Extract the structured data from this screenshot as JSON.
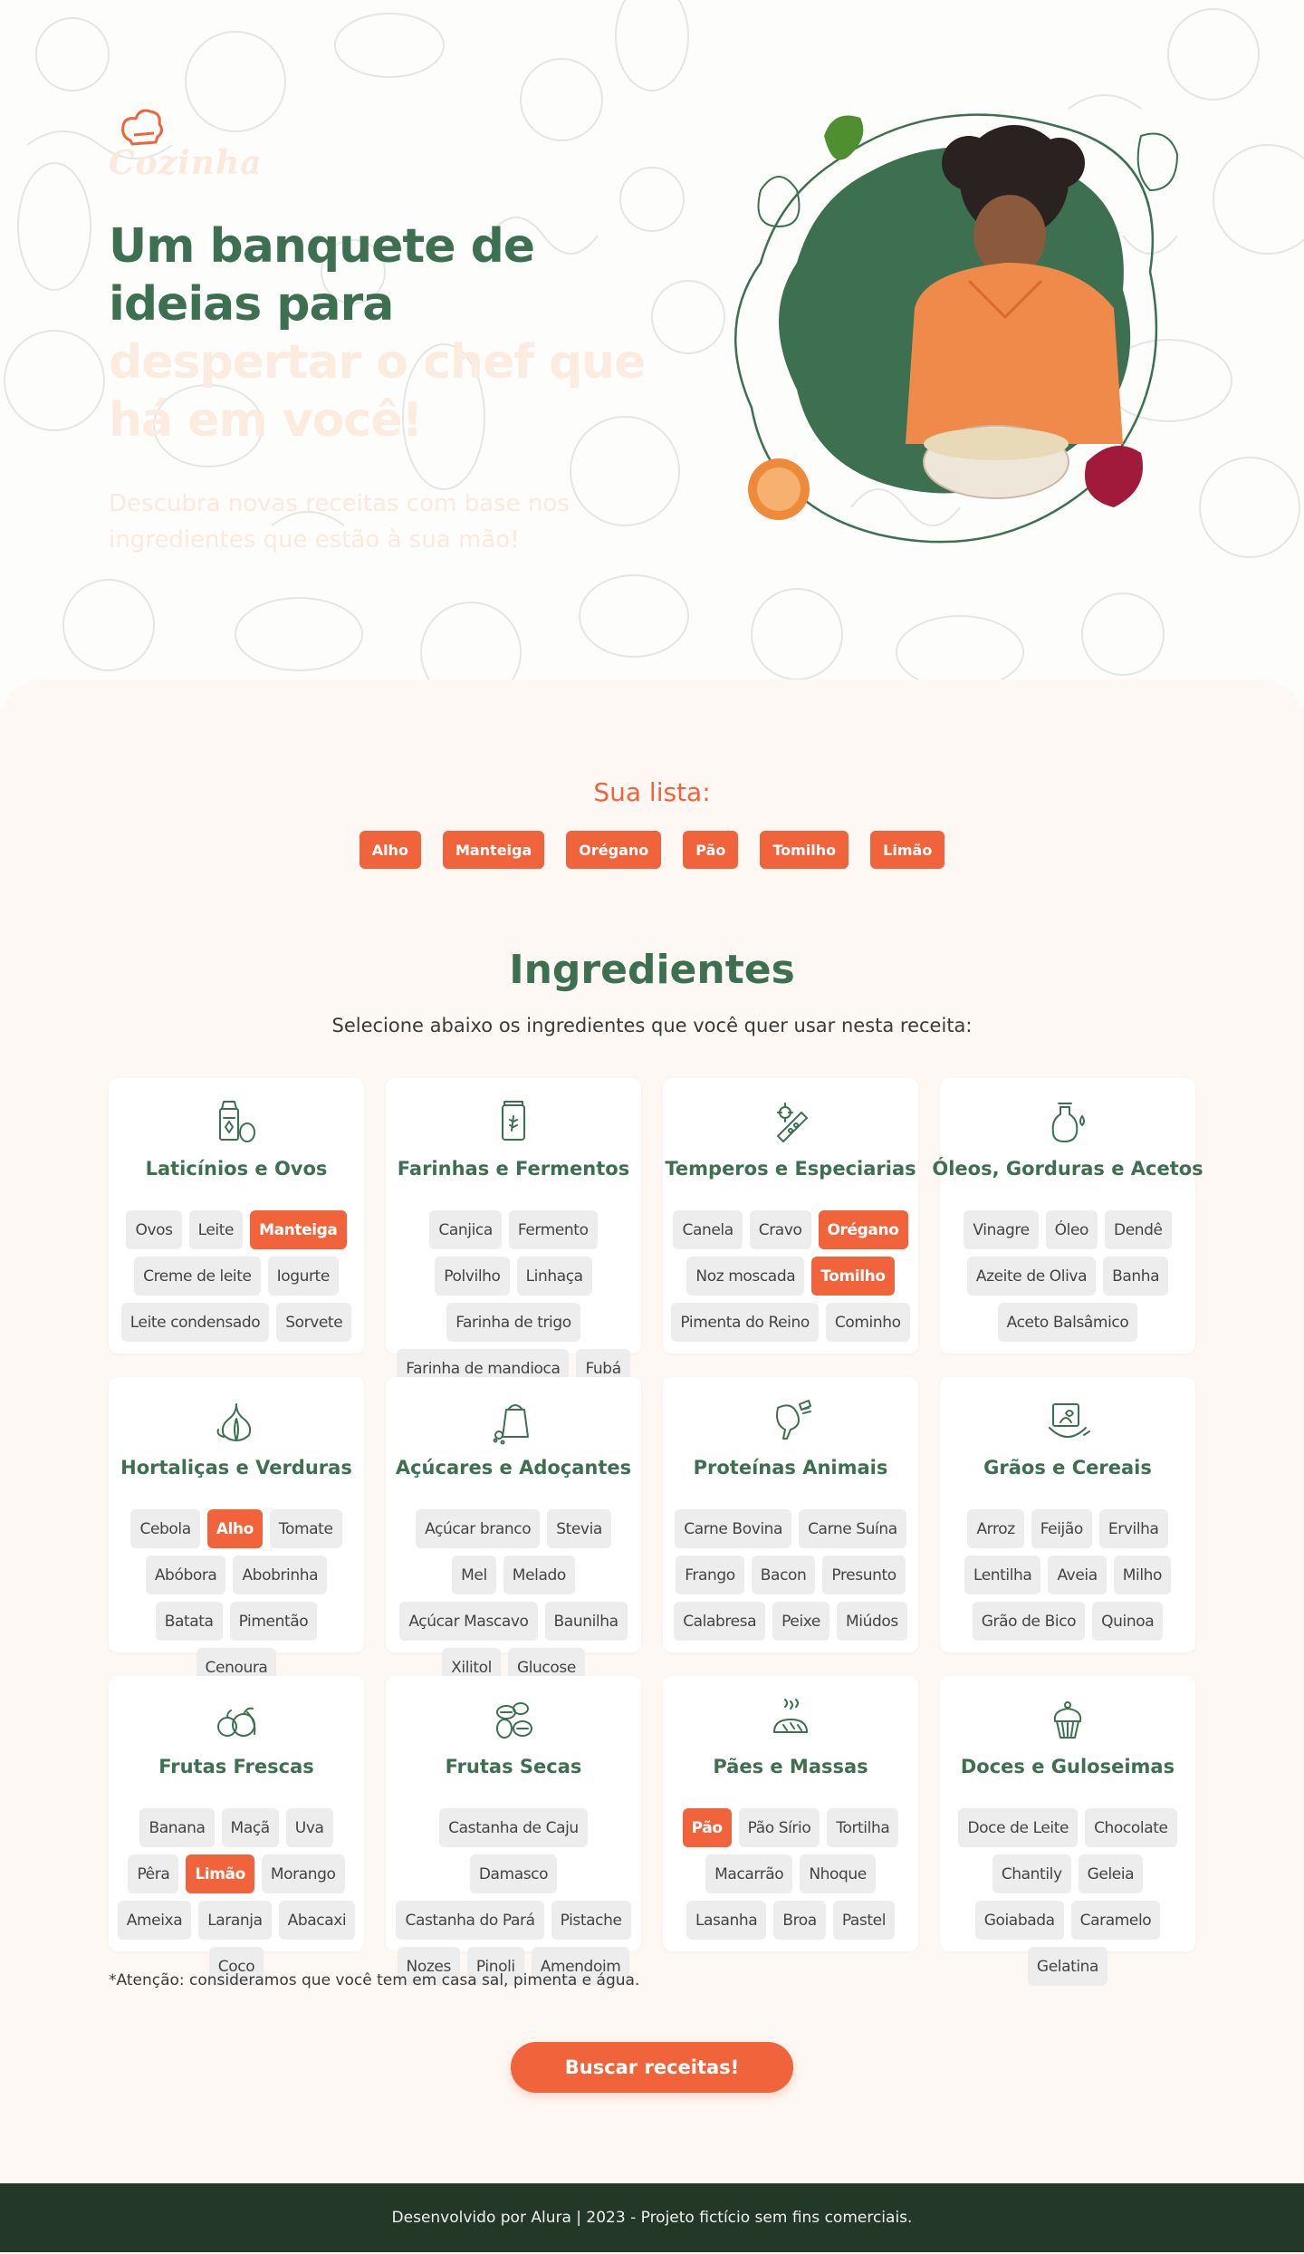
{
  "brand": {
    "logo_text": "Cozinha",
    "accent_orange": "#f0633b",
    "accent_green": "#3d7050",
    "footer_bg": "#233826"
  },
  "hero": {
    "title_line1": "Um banquete de",
    "title_line2": "ideias para",
    "title_line3": "despertar o chef que",
    "title_line4": "há em você!",
    "subtitle": "Descubra novas receitas com base nos ingredientes que estão à sua mão!"
  },
  "list": {
    "title": "Sua lista:",
    "items": [
      "Alho",
      "Manteiga",
      "Orégano",
      "Pão",
      "Tomilho",
      "Limão"
    ]
  },
  "ingredients": {
    "title": "Ingredientes",
    "subtitle": "Selecione abaixo os ingredientes que você quer usar nesta receita:",
    "categories": [
      {
        "name": "Laticínios e Ovos",
        "icon": "milk-egg-icon",
        "items": [
          {
            "label": "Ovos",
            "selected": false
          },
          {
            "label": "Leite",
            "selected": false
          },
          {
            "label": "Manteiga",
            "selected": true
          },
          {
            "label": "Creme de leite",
            "selected": false
          },
          {
            "label": "Iogurte",
            "selected": false
          },
          {
            "label": "Leite condensado",
            "selected": false
          },
          {
            "label": "Sorvete",
            "selected": false
          }
        ]
      },
      {
        "name": "Farinhas e Fermentos",
        "icon": "flour-jar-icon",
        "items": [
          {
            "label": "Canjica",
            "selected": false
          },
          {
            "label": "Fermento",
            "selected": false
          },
          {
            "label": "Polvilho",
            "selected": false
          },
          {
            "label": "Linhaça",
            "selected": false
          },
          {
            "label": "Farinha de trigo",
            "selected": false
          },
          {
            "label": "Farinha de mandioca",
            "selected": false
          },
          {
            "label": "Fubá",
            "selected": false
          }
        ]
      },
      {
        "name": "Temperos e Especiarias",
        "icon": "spices-icon",
        "items": [
          {
            "label": "Canela",
            "selected": false
          },
          {
            "label": "Cravo",
            "selected": false
          },
          {
            "label": "Orégano",
            "selected": true
          },
          {
            "label": "Noz moscada",
            "selected": false
          },
          {
            "label": "Tomilho",
            "selected": true
          },
          {
            "label": "Pimenta do Reino",
            "selected": false
          },
          {
            "label": "Cominho",
            "selected": false
          }
        ]
      },
      {
        "name": "Óleos, Gorduras e Acetos",
        "icon": "oil-bottle-icon",
        "items": [
          {
            "label": "Vinagre",
            "selected": false
          },
          {
            "label": "Óleo",
            "selected": false
          },
          {
            "label": "Dendê",
            "selected": false
          },
          {
            "label": "Azeite de Oliva",
            "selected": false
          },
          {
            "label": "Banha",
            "selected": false
          },
          {
            "label": "Aceto Balsâmico",
            "selected": false
          }
        ]
      },
      {
        "name": "Hortaliças e Verduras",
        "icon": "garlic-icon",
        "items": [
          {
            "label": "Cebola",
            "selected": false
          },
          {
            "label": "Alho",
            "selected": true
          },
          {
            "label": "Tomate",
            "selected": false
          },
          {
            "label": "Abóbora",
            "selected": false
          },
          {
            "label": "Abobrinha",
            "selected": false
          },
          {
            "label": "Batata",
            "selected": false
          },
          {
            "label": "Pimentão",
            "selected": false
          },
          {
            "label": "Cenoura",
            "selected": false
          }
        ]
      },
      {
        "name": "Açúcares e Adoçantes",
        "icon": "sugar-bag-icon",
        "items": [
          {
            "label": "Açúcar branco",
            "selected": false
          },
          {
            "label": "Stevia",
            "selected": false
          },
          {
            "label": "Mel",
            "selected": false
          },
          {
            "label": "Melado",
            "selected": false
          },
          {
            "label": "Açúcar Mascavo",
            "selected": false
          },
          {
            "label": "Baunilha",
            "selected": false
          },
          {
            "label": "Xilitol",
            "selected": false
          },
          {
            "label": "Glucose",
            "selected": false
          }
        ]
      },
      {
        "name": "Proteínas Animais",
        "icon": "meat-icon",
        "items": [
          {
            "label": "Carne Bovina",
            "selected": false
          },
          {
            "label": "Carne Suína",
            "selected": false
          },
          {
            "label": "Frango",
            "selected": false
          },
          {
            "label": "Bacon",
            "selected": false
          },
          {
            "label": "Presunto",
            "selected": false
          },
          {
            "label": "Calabresa",
            "selected": false
          },
          {
            "label": "Peixe",
            "selected": false
          },
          {
            "label": "Miúdos",
            "selected": false
          }
        ]
      },
      {
        "name": "Grãos e Cereais",
        "icon": "grain-icon",
        "items": [
          {
            "label": "Arroz",
            "selected": false
          },
          {
            "label": "Feijão",
            "selected": false
          },
          {
            "label": "Ervilha",
            "selected": false
          },
          {
            "label": "Lentilha",
            "selected": false
          },
          {
            "label": "Aveia",
            "selected": false
          },
          {
            "label": "Milho",
            "selected": false
          },
          {
            "label": "Grão de Bico",
            "selected": false
          },
          {
            "label": "Quinoa",
            "selected": false
          }
        ]
      },
      {
        "name": "Frutas Frescas",
        "icon": "fruits-icon",
        "items": [
          {
            "label": "Banana",
            "selected": false
          },
          {
            "label": "Maçã",
            "selected": false
          },
          {
            "label": "Uva",
            "selected": false
          },
          {
            "label": "Pêra",
            "selected": false
          },
          {
            "label": "Limão",
            "selected": true
          },
          {
            "label": "Morango",
            "selected": false
          },
          {
            "label": "Ameixa",
            "selected": false
          },
          {
            "label": "Laranja",
            "selected": false
          },
          {
            "label": "Abacaxi",
            "selected": false
          },
          {
            "label": "Coco",
            "selected": false
          }
        ]
      },
      {
        "name": "Frutas Secas",
        "icon": "nuts-icon",
        "items": [
          {
            "label": "Castanha de Caju",
            "selected": false
          },
          {
            "label": "Damasco",
            "selected": false
          },
          {
            "label": "Castanha do Pará",
            "selected": false
          },
          {
            "label": "Pistache",
            "selected": false
          },
          {
            "label": "Nozes",
            "selected": false
          },
          {
            "label": "Pinoli",
            "selected": false
          },
          {
            "label": "Amendoim",
            "selected": false
          }
        ]
      },
      {
        "name": "Pães e Massas",
        "icon": "bread-icon",
        "items": [
          {
            "label": "Pão",
            "selected": true
          },
          {
            "label": "Pão Sírio",
            "selected": false
          },
          {
            "label": "Tortilha",
            "selected": false
          },
          {
            "label": "Macarrão",
            "selected": false
          },
          {
            "label": "Nhoque",
            "selected": false
          },
          {
            "label": "Lasanha",
            "selected": false
          },
          {
            "label": "Broa",
            "selected": false
          },
          {
            "label": "Pastel",
            "selected": false
          }
        ]
      },
      {
        "name": "Doces e Guloseimas",
        "icon": "cupcake-icon",
        "items": [
          {
            "label": "Doce de Leite",
            "selected": false
          },
          {
            "label": "Chocolate",
            "selected": false
          },
          {
            "label": "Chantily",
            "selected": false
          },
          {
            "label": "Geleia",
            "selected": false
          },
          {
            "label": "Goiabada",
            "selected": false
          },
          {
            "label": "Caramelo",
            "selected": false
          },
          {
            "label": "Gelatina",
            "selected": false
          }
        ]
      }
    ],
    "note": "*Atenção: consideramos que você tem em casa sal, pimenta e água."
  },
  "cta": {
    "search_label": "Buscar receitas!"
  },
  "footer": {
    "text": "Desenvolvido por Alura | 2023 - Projeto fictício sem fins comerciais."
  }
}
